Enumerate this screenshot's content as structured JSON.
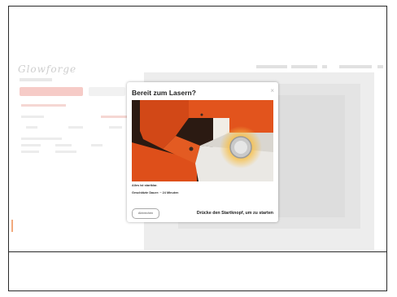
{
  "modal": {
    "title": "Bereit zum Lasern?",
    "close_glyph": "×",
    "info_line1": "Alles ist startklar.",
    "info_line2": "Geschätzte Dauer: ~ 24 Minuten",
    "cancel_label": "Abbrechen",
    "hint": "Drücke den Startknopf, um zu starten",
    "image_subject": "orange laser-cutter lid with illuminated start button",
    "close_icon": "close-icon"
  },
  "background_app": {
    "logo_text": "Glowforge",
    "icons": [
      "logo-icon"
    ]
  },
  "colors": {
    "accent_red": "#f6c6c1",
    "machine_orange": "#e8531f",
    "button_metal": "#c8c8c8",
    "button_glow": "#f5b43c"
  }
}
